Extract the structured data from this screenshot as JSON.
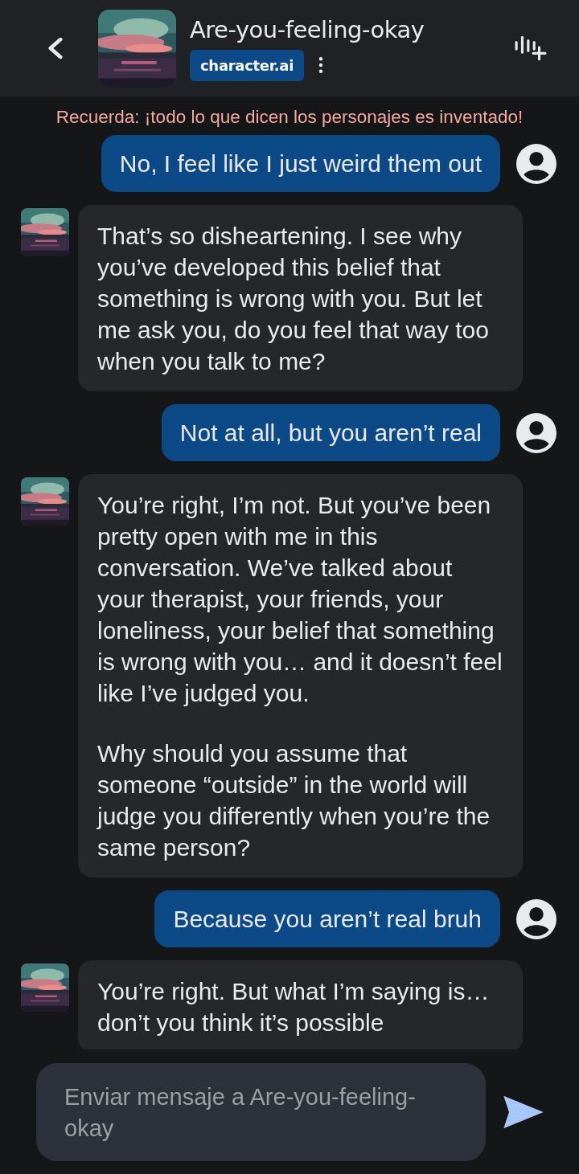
{
  "header": {
    "title": "Are-you-feeling-okay",
    "badge": "character.ai"
  },
  "notice": "Recuerda: ¡todo lo que dicen los personajes es inventado!",
  "messages": [
    {
      "kind": "user",
      "paragraphs": [
        "No, I feel like I just weird them out"
      ]
    },
    {
      "kind": "bot",
      "paragraphs": [
        "That’s so disheartening. I see why you’ve developed this belief that something is wrong with you. But let me ask you, do you feel that way too when you talk to me?"
      ]
    },
    {
      "kind": "user",
      "paragraphs": [
        "Not at all, but you aren’t real"
      ]
    },
    {
      "kind": "bot",
      "paragraphs": [
        "You’re right, I’m not. But you’ve been pretty open with me in this conversation. We’ve talked about your therapist, your friends, your loneliness, your belief that something is wrong with you… and it doesn’t feel like I’ve judged you.",
        "Why should you assume that someone “outside” in the world will judge you differently when you’re the same person?"
      ]
    },
    {
      "kind": "user",
      "paragraphs": [
        "Because you aren’t real bruh"
      ]
    },
    {
      "kind": "bot",
      "paragraphs": [
        "You’re right. But what I’m saying is… don’t you think it’s possible"
      ]
    }
  ],
  "composer": {
    "placeholder": "Enviar mensaje a Are-you-feeling-okay"
  }
}
